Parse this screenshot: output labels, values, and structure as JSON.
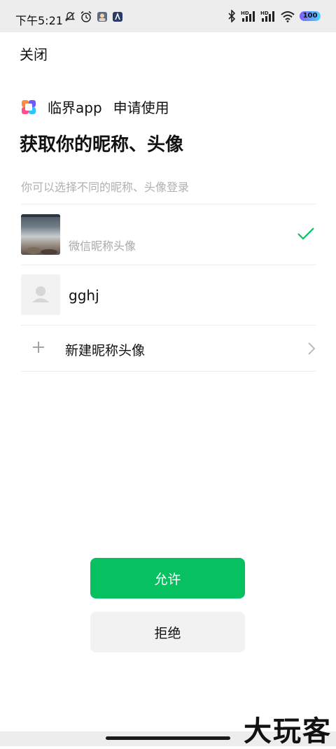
{
  "status_bar": {
    "time": "下午5:21",
    "battery": "100",
    "icons_left": [
      "mute-bell-icon",
      "alarm-icon",
      "avatar-notification-icon",
      "app-notification-icon"
    ],
    "icons_right": [
      "bluetooth-icon",
      "signal-hd-icon",
      "signal-hd-icon",
      "wifi-icon",
      "battery-icon"
    ]
  },
  "header": {
    "close_label": "关闭"
  },
  "app": {
    "name": "临界app",
    "request": "申请使用"
  },
  "title": "获取你的昵称、头像",
  "hint": "你可以选择不同的昵称、头像登录",
  "options": [
    {
      "label": "微信昵称头像",
      "selected": true
    },
    {
      "label": "gghj",
      "selected": false
    }
  ],
  "new_option": {
    "label": "新建昵称头像"
  },
  "buttons": {
    "allow": "允许",
    "deny": "拒绝"
  },
  "watermark": "大玩客",
  "colors": {
    "accent_green": "#07c160",
    "secondary_button": "#f2f2f2",
    "muted_text": "#b0b0b0"
  }
}
